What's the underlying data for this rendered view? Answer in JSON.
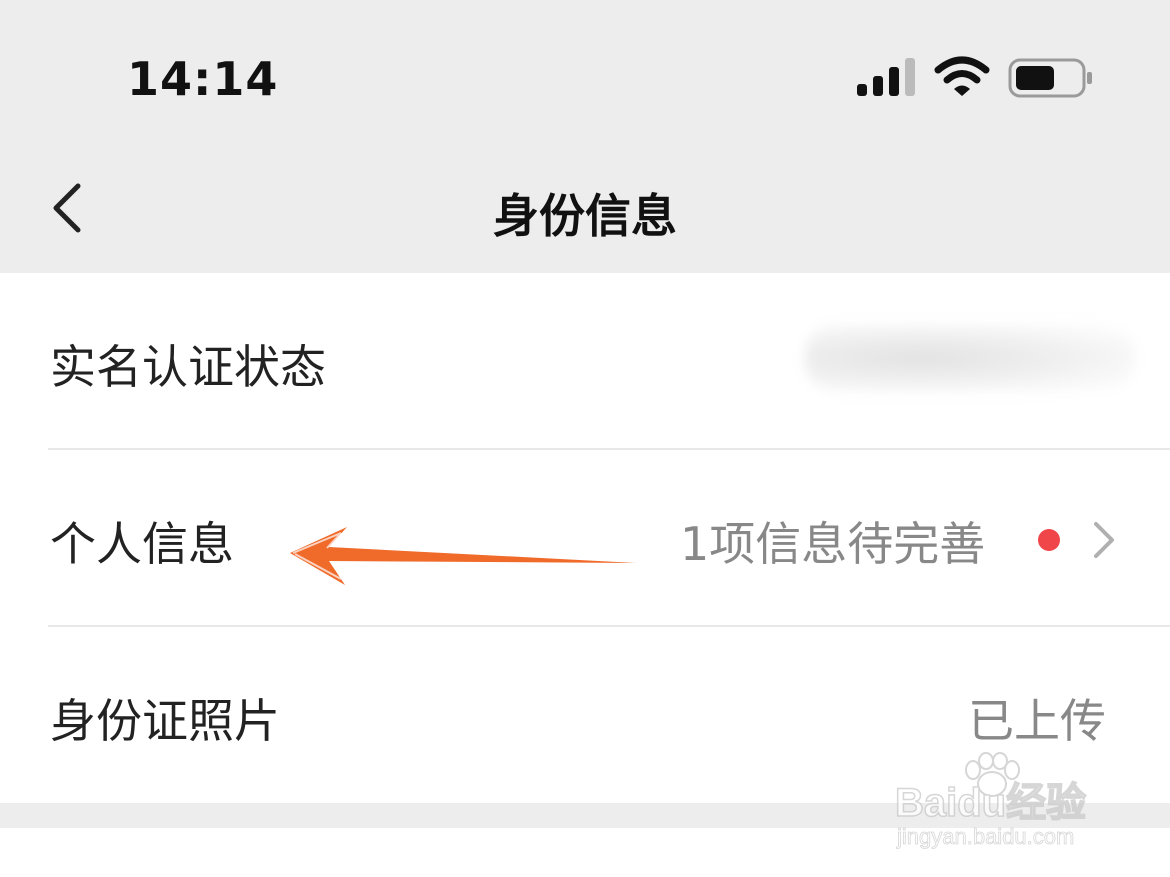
{
  "status_bar": {
    "time": "14:14",
    "icons": [
      "signal-icon",
      "wifi-icon",
      "battery-icon"
    ]
  },
  "nav": {
    "back_icon": "chevron-left-icon",
    "title": "身份信息"
  },
  "rows": [
    {
      "label": "实名认证状态",
      "value": ""
    },
    {
      "label": "个人信息",
      "value": "1项信息待完善",
      "badge": "red-dot",
      "chevron": "chevron-right-icon"
    },
    {
      "label": "身份证照片",
      "value": "已上传"
    }
  ],
  "colors": {
    "header_bg": "#ededed",
    "badge": "#f0464a",
    "arrow": "#f06a2a"
  },
  "watermark": {
    "line1": "Baidu经验",
    "line2": "jingyan.baidu.com"
  }
}
